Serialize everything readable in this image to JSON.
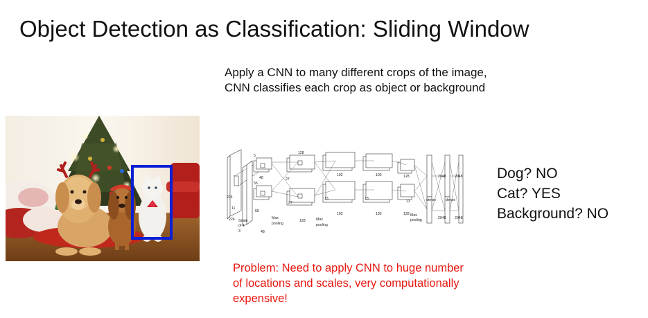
{
  "slide": {
    "title": "Object Detection as Classification: Sliding Window",
    "description": "Apply a CNN to many different crops of the image, CNN classifies each crop as object or background",
    "results": [
      "Dog? NO",
      "Cat? YES",
      "Background? NO"
    ],
    "problem": "Problem: Need to apply CNN to huge number of locations and scales, very computationally expensive!"
  },
  "photo": {
    "window_color": "#0a1fd6"
  },
  "cnn_diagram": {
    "labels": {
      "in_size": "224",
      "in_size_b": "224",
      "stride": "Stride",
      "of_4": "of 4",
      "three": "3",
      "k11": "11",
      "k5": "5",
      "c48": "48",
      "c48b": "48",
      "c128": "128",
      "c128b": "128",
      "c192": "192",
      "c192b": "192",
      "c192c": "192",
      "c192d": "192",
      "c128c": "128",
      "c128d": "128",
      "n27": "27",
      "n27b": "27",
      "n13": "13",
      "n13b": "13",
      "n13c": "13",
      "n55": "55",
      "n55b": "55",
      "maxpool1": "Max",
      "pooling1": "pooling",
      "maxpool2": "Max",
      "pooling2": "pooling",
      "maxpool3": "Max",
      "pooling3": "pooling",
      "dense1": "dense",
      "dense2": "dense",
      "f2048a": "2048",
      "f2048b": "2048",
      "f2048c": "2048",
      "f2048d": "2048"
    }
  }
}
